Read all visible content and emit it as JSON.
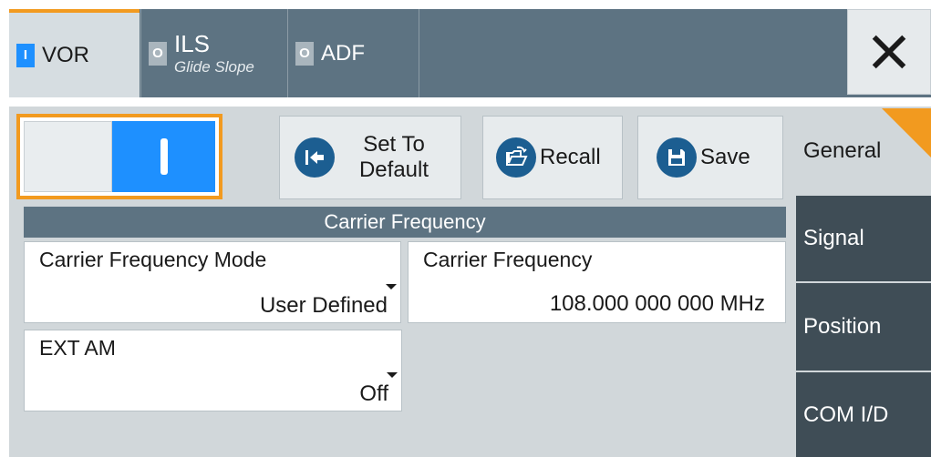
{
  "tabs": [
    {
      "indicator": "I",
      "label": "VOR",
      "active": true
    },
    {
      "indicator": "O",
      "label": "ILS",
      "sublabel": "Glide Slope",
      "active": false
    },
    {
      "indicator": "O",
      "label": "ADF",
      "active": false
    }
  ],
  "toolbar": {
    "set_default_label": "Set To Default",
    "recall_label": "Recall",
    "save_label": "Save"
  },
  "toggle": {
    "state": "on"
  },
  "section": {
    "title": "Carrier Frequency"
  },
  "fields": {
    "carrier_mode": {
      "label": "Carrier Frequency Mode",
      "value": "User Defined"
    },
    "carrier_freq": {
      "label": "Carrier Frequency",
      "value": "108.000 000 000 MHz"
    },
    "ext_am": {
      "label": "EXT AM",
      "value": "Off"
    }
  },
  "side_tabs": [
    {
      "label": "General",
      "active": true
    },
    {
      "label": "Signal",
      "active": false
    },
    {
      "label": "Position",
      "active": false
    },
    {
      "label": "COM I/D",
      "active": false
    }
  ],
  "colors": {
    "accent": "#f29a1f",
    "toggle_on": "#1e90ff",
    "header_bg": "#5d7382",
    "side_tab_bg": "#3f4d56",
    "icon_blue": "#1c5e91"
  },
  "icons": {
    "set_default": "arrow-left-into-bar-icon",
    "recall": "folder-open-icon",
    "save": "floppy-disk-icon",
    "close": "close-icon"
  }
}
